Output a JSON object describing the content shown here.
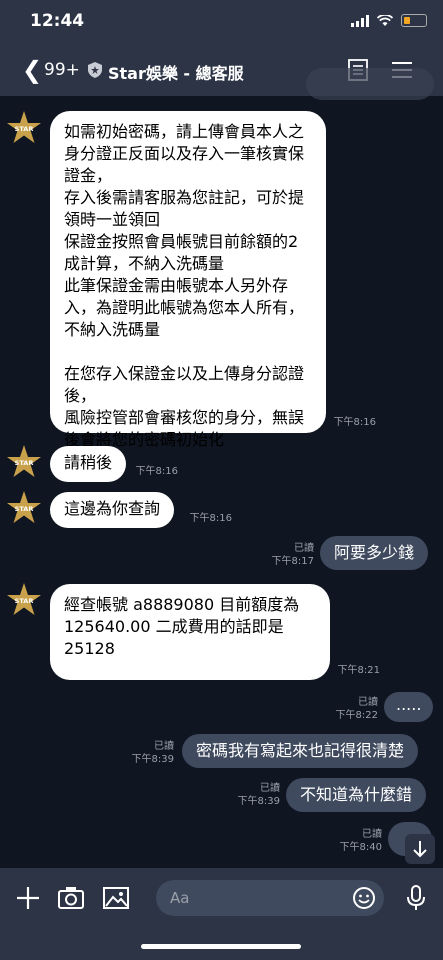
{
  "status": {
    "time": "12:44"
  },
  "header": {
    "back_count": "99+",
    "title": "Star娛樂 - 總客服"
  },
  "incoming": [
    {
      "text": "如需初始密碼，請上傳會員本人之身分證正反面以及存入一筆核實保證金，\n存入後需請客服為您註記，可於提領時一並領回\n保證金按照會員帳號目前餘額的2 成計算，不納入洗碼量\n此筆保證金需由帳號本人另外存入，為證明此帳號為您本人所有，不納入洗碼量\n\n在您存入保證金以及上傳身分認證後，\n風險控管部會審核您的身分，無誤後會將您的密碼初始化",
      "time": "下午8:16"
    },
    {
      "text": "請稍後",
      "time": "下午8:16"
    },
    {
      "text": "這邊為你查詢",
      "time": "下午8:16"
    },
    {
      "text": "經查帳號 a8889080 目前額度為125640.00 二成費用的話即是25128",
      "time": "下午8:21"
    }
  ],
  "outgoing": [
    {
      "text": "阿要多少錢",
      "read": "已讀",
      "time": "下午8:17"
    },
    {
      "text": ".....",
      "read": "已讀",
      "time": "下午8:22"
    },
    {
      "text": "密碼我有寫起來也記得很清楚",
      "read": "已讀",
      "time": "下午8:39"
    },
    {
      "text": "不知道為什麼錯",
      "read": "已讀",
      "time": "下午8:39"
    },
    {
      "text": "",
      "read": "已讀",
      "time": "下午8:40"
    }
  ],
  "input": {
    "placeholder": "Aa"
  },
  "icons": [
    "back-chevron",
    "shield-icon",
    "notes-icon",
    "menu-icon",
    "star-avatar",
    "plus-icon",
    "camera-icon",
    "image-icon",
    "emoji-icon",
    "mic-icon",
    "scroll-down-icon"
  ]
}
